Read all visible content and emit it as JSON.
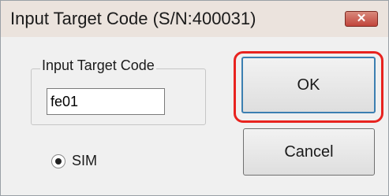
{
  "window": {
    "title": "Input Target Code (S/N:400031)",
    "close_icon": "close-icon",
    "close_glyph": "✕"
  },
  "group": {
    "label": "Input Target Code"
  },
  "input": {
    "value": "fe01"
  },
  "radio": {
    "label": "SIM",
    "selected": true
  },
  "buttons": {
    "ok_label": "OK",
    "cancel_label": "Cancel"
  },
  "colors": {
    "highlight": "#e8231f",
    "close_button": "#c1443b"
  }
}
